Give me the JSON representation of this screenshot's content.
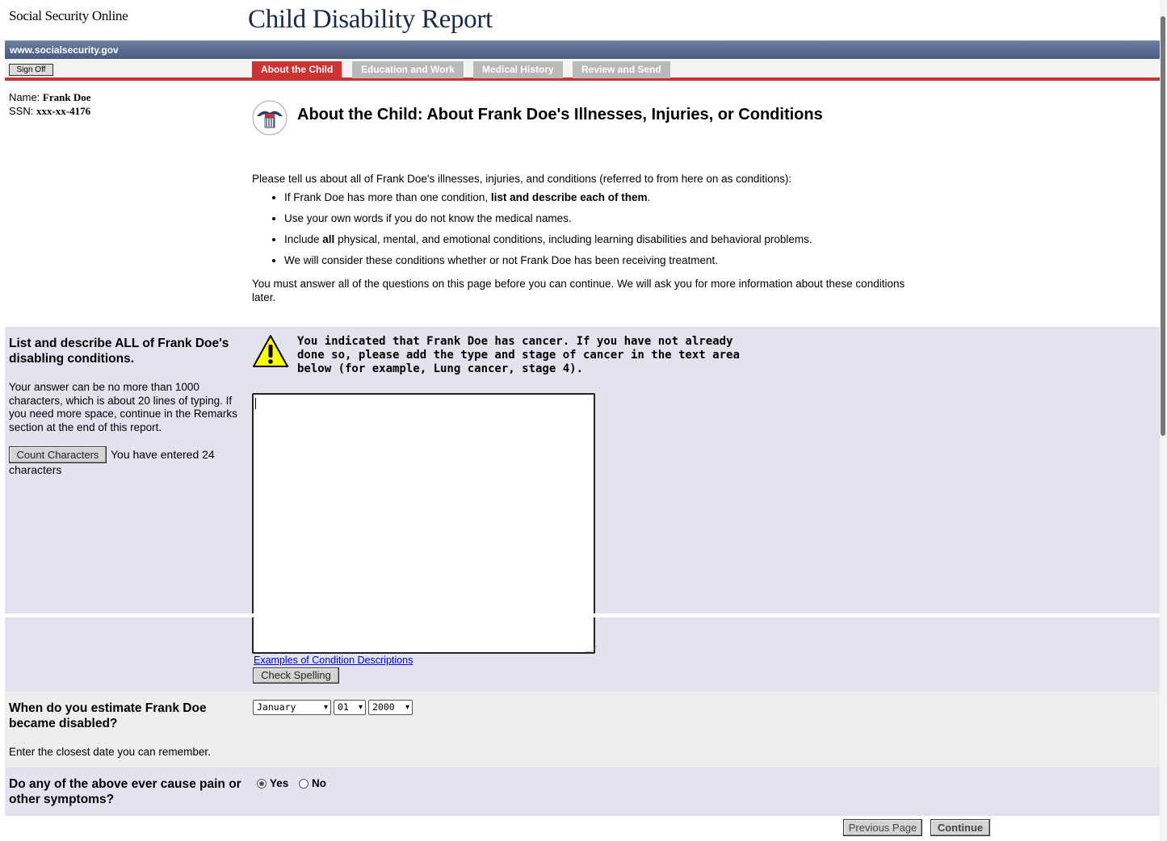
{
  "header": {
    "site_name": "Social Security Online",
    "report_title": "Child Disability Report",
    "url": "www.socialsecurity.gov",
    "sign_off": "Sign Off"
  },
  "tabs": [
    {
      "label": "About the Child",
      "active": true
    },
    {
      "label": "Education and Work",
      "active": false
    },
    {
      "label": "Medical History",
      "active": false
    },
    {
      "label": "Review and Send",
      "active": false
    }
  ],
  "identity": {
    "name_label": "Name:",
    "name_value": "Frank Doe",
    "ssn_label": "SSN:",
    "ssn_value": "xxx-xx-4176"
  },
  "main": {
    "title": "About the Child: About Frank Doe's Illnesses, Injuries, or Conditions",
    "intro": "Please tell us about all of Frank Doe's illnesses, injuries, and conditions (referred to from here on as conditions):",
    "bullets": {
      "b1_pre": "If Frank Doe has more than one condition, ",
      "b1_bold": "list and describe each of them",
      "b1_post": ".",
      "b2": "Use your own words if you do not know the medical names.",
      "b3_pre": "Include ",
      "b3_bold": "all",
      "b3_post": " physical, mental, and emotional conditions, including learning disabilities and behavioral problems.",
      "b4": "We will consider these conditions whether or not Frank Doe has been receiving treatment."
    },
    "must_answer": "You must answer all of the questions on this page before you can continue. We will ask you for more information about these conditions later."
  },
  "conditions": {
    "question": "List and describe ALL of Frank Doe's disabling conditions.",
    "help": "Your answer can be no more than 1000 characters, which is about 20 lines of typing. If you need more space, continue in the Remarks section at the end of this report.",
    "count_button": "Count Characters",
    "count_text_1": "You have entered 24",
    "count_text_2": "characters",
    "warning": "You indicated that Frank Doe has cancer. If you have not already done so, please add the type and stage of cancer in the text area below (for example, Lung cancer, stage 4).",
    "textarea_value": "",
    "examples_link": "Examples of Condition Descriptions",
    "spell_button": "Check Spelling"
  },
  "onset": {
    "question": "When do you estimate Frank Doe became disabled?",
    "help": "Enter the closest date you can remember.",
    "month": "January",
    "day": "01",
    "year": "2000"
  },
  "pain": {
    "question": "Do any of the above ever cause pain or other symptoms?",
    "yes_label": "Yes",
    "no_label": "No",
    "selected": "Yes"
  },
  "nav": {
    "previous": "Previous Page",
    "continue": "Continue"
  },
  "colors": {
    "active_tab": "#cc3333",
    "inactive_tab": "#b9b9b9",
    "header_bar": "#4a5a80",
    "section_bg": "#e3e3f0",
    "warning_yellow": "#ffff00"
  }
}
